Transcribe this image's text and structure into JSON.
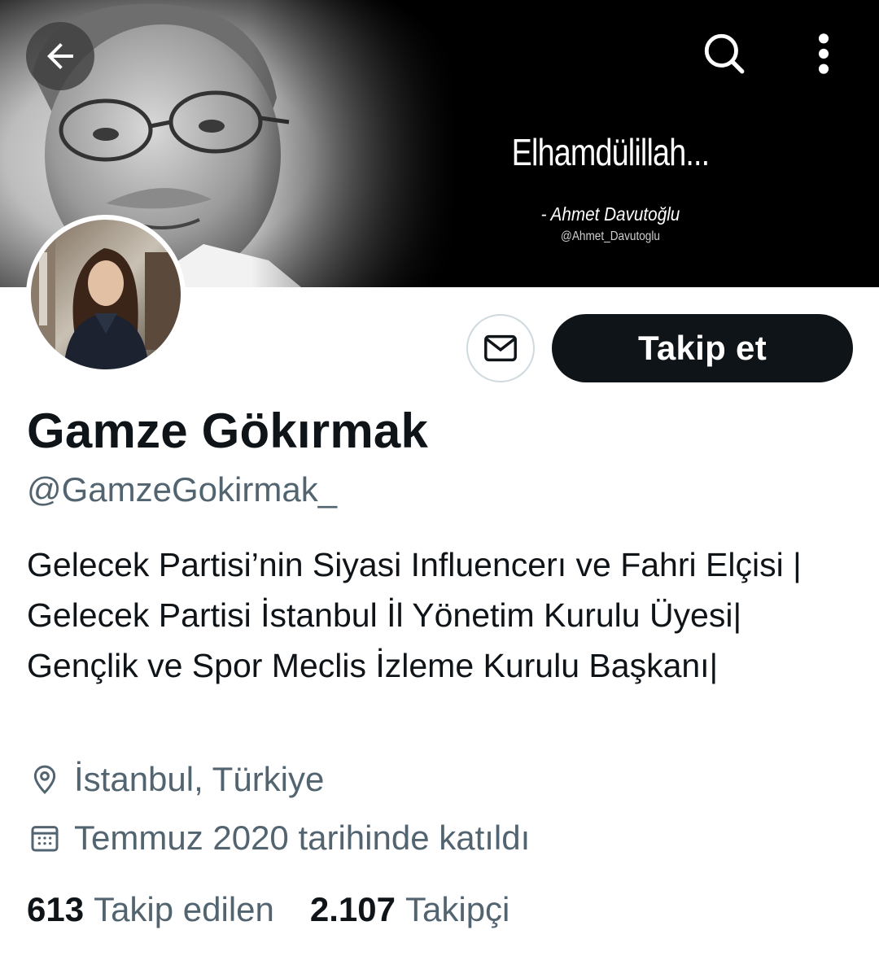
{
  "header": {
    "back_icon": "arrow-left-icon",
    "search_icon": "search-icon",
    "more_icon": "more-vertical-icon"
  },
  "banner": {
    "quote": "Elhamdülillah...",
    "author": "- Ahmet Davutoğlu",
    "handle": "@Ahmet_Davutoglu"
  },
  "profile": {
    "name": "Gamze Gökırmak",
    "handle": "@GamzeGokirmak_",
    "bio": "Gelecek Partisi’nin Siyasi Influencerı ve Fahri Elçisi | Gelecek Partisi İstanbul İl Yönetim Kurulu Üyesi| Gençlik ve Spor Meclis İzleme Kurulu Başkanı|",
    "location": "İstanbul, Türkiye",
    "joined": "Temmuz 2020 tarihinde katıldı"
  },
  "actions": {
    "message_icon": "envelope-icon",
    "follow_label": "Takip et"
  },
  "stats": {
    "following_count": "613",
    "following_label": "Takip edilen",
    "followers_count": "2.107",
    "followers_label": "Takipçi"
  },
  "colors": {
    "primary_text": "#0f1419",
    "secondary_text": "#536471",
    "border": "#cfd9de",
    "follow_bg": "#0f1419"
  }
}
